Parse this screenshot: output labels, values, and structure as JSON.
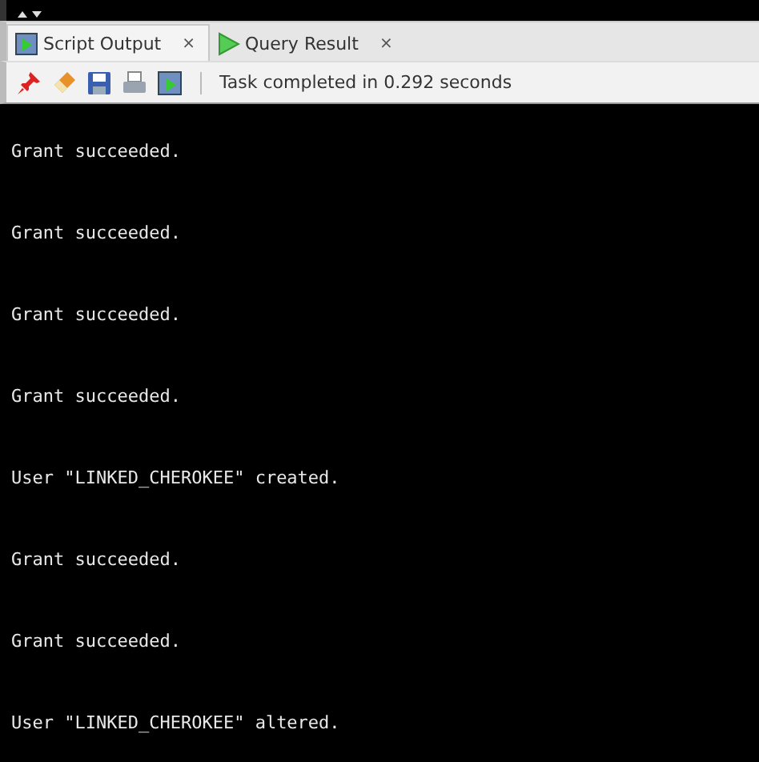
{
  "tabs": [
    {
      "label": "Script Output",
      "close": "×",
      "selected": true,
      "kind": "script"
    },
    {
      "label": "Query Result",
      "close": "×",
      "selected": false,
      "kind": "query"
    }
  ],
  "toolbar": {
    "status": "Task completed in 0.292 seconds"
  },
  "output": [
    "Grant succeeded.",
    "Grant succeeded.",
    "Grant succeeded.",
    "Grant succeeded.",
    "User \"LINKED_CHEROKEE\" created.",
    "Grant succeeded.",
    "Grant succeeded.",
    "User \"LINKED_CHEROKEE\" altered."
  ]
}
